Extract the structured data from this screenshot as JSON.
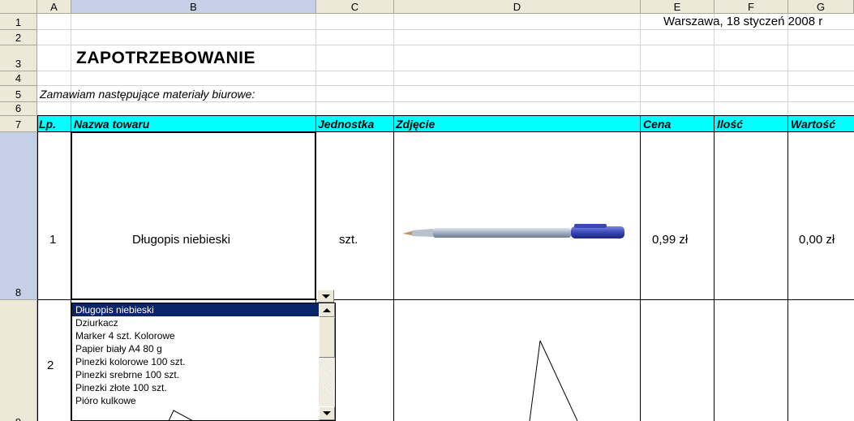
{
  "columns": [
    "A",
    "B",
    "C",
    "D",
    "E",
    "F",
    "G"
  ],
  "rows": [
    "1",
    "2",
    "3",
    "4",
    "5",
    "6",
    "7",
    "8",
    "9"
  ],
  "cells": {
    "date": "Warszawa, 18 styczeń 2008 r",
    "title": "ZAPOTRZEBOWANIE",
    "intro": "Zamawiam następujące materiały biurowe:",
    "headers": [
      "Lp.",
      "Nazwa towaru",
      "Jednostka",
      "Zdjęcie",
      "Cena",
      "Ilość",
      "Wartość"
    ],
    "row1": {
      "lp": "1",
      "name": "Długopis niebieski",
      "unit": "szt.",
      "price": "0,99 zł",
      "qty": "",
      "value": "0,00 zł"
    },
    "row2": {
      "lp": "2"
    }
  },
  "dropdown": {
    "selected": "Długopis niebieski",
    "options": [
      "Długopis niebieski",
      "Dziurkacz",
      "Marker 4 szt. Kolorowe",
      "Papier biały A4 80 g",
      "Pinezki kolorowe 100 szt.",
      "Pinezki srebrne 100 szt.",
      "Pinezki złote 100 szt.",
      "Pióro kulkowe"
    ]
  },
  "colors": {
    "header_fill": "#00ffff",
    "selection": "#0a246a",
    "chrome": "#ece9d8"
  },
  "icons": {
    "dropdown_arrow": "chevron-down-icon",
    "pen_image": "pen-image"
  }
}
